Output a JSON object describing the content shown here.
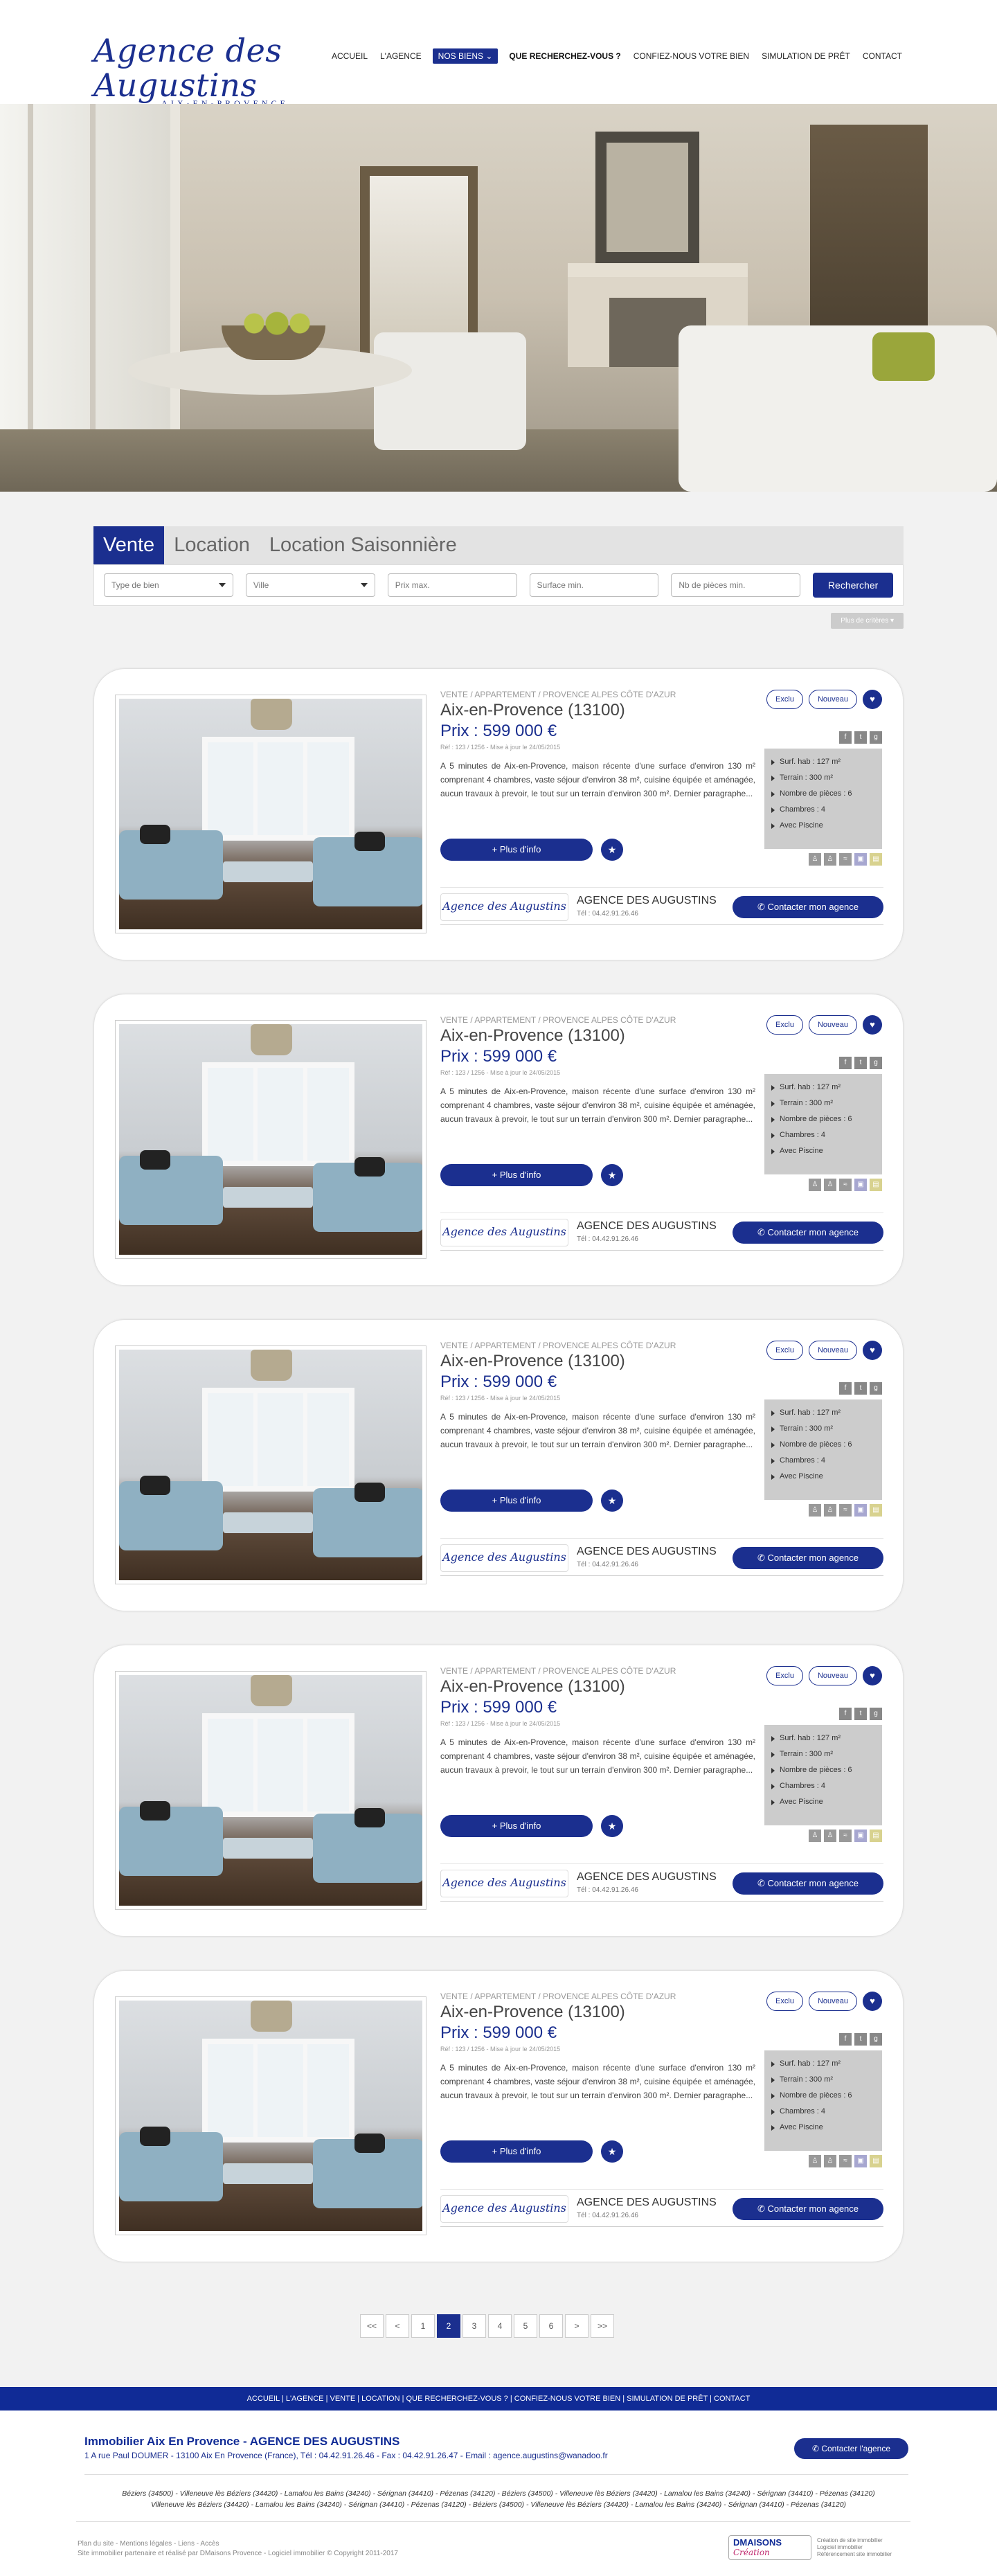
{
  "header": {
    "logo_name": "Agence des Augustins",
    "logo_sub": "AIX-EN-PROVENCE",
    "nav": [
      {
        "label": "ACCUEIL",
        "style": ""
      },
      {
        "label": "L'AGENCE",
        "style": ""
      },
      {
        "label": "NOS BIENS ⌄",
        "style": "active"
      },
      {
        "label": "QUE RECHERCHEZ-VOUS ?",
        "style": "bold"
      },
      {
        "label": "CONFIEZ-NOUS VOTRE BIEN",
        "style": ""
      },
      {
        "label": "SIMULATION DE PRÊT",
        "style": ""
      },
      {
        "label": "CONTACT",
        "style": ""
      }
    ]
  },
  "search": {
    "tabs": [
      "Vente",
      "Location",
      "Location Saisonnière"
    ],
    "fields": {
      "type": "Type de bien",
      "ville": "Ville",
      "prix": "Prix max.",
      "surface": "Surface min.",
      "pieces": "Nb de pièces min."
    },
    "button": "Rechercher",
    "more": "Plus de critères ▾"
  },
  "listing": {
    "breadcrumb": "VENTE / APPARTEMENT / PROVENCE ALPES CÔTE D'AZUR",
    "city": "Aix-en-Provence (13100)",
    "price": "Prix : 599 000 €",
    "ref": "Réf : 123 / 1256 - Mise à jour le 24/05/2015",
    "desc": "A 5 minutes de Aix-en-Provence, maison récente d'une surface d'environ 130 m² comprenant 4 chambres, vaste séjour d'environ 38 m², cuisine équipée et aménagée, aucun travaux à prevoir, le tout sur un terrain d'environ 300 m². Dernier paragraphe...",
    "info_button": "+  Plus d'info",
    "badge_exclu": "Exclu",
    "badge_new": "Nouveau",
    "features": [
      "Surf. hab : 127 m²",
      "Terrain : 300 m²",
      "Nombre de pièces : 6",
      "Chambres : 4",
      "Avec Piscine"
    ],
    "agency_logo": "Agence des Augustins",
    "agency_name": "AGENCE DES AUGUSTINS",
    "agency_tel": "Tél : 04.42.91.26.46",
    "contact_button": "Contacter mon agence"
  },
  "pagination": [
    "<<",
    "<",
    "1",
    "2",
    "3",
    "4",
    "5",
    "6",
    ">",
    ">>"
  ],
  "pagination_active": "2",
  "footer": {
    "nav": "ACCUEIL  |  L'AGENCE  |  VENTE  |  LOCATION  |  QUE RECHERCHEZ-VOUS ?  |  CONFIEZ-NOUS VOTRE BIEN  |  SIMULATION DE PRÊT  |  CONTACT",
    "title": "Immobilier Aix En Provence - AGENCE DES AUGUSTINS",
    "address": "1 A rue Paul DOUMER - 13100 Aix En Provence (France), Tél : 04.42.91.26.46 - Fax : 04.42.91.26.47 - Email : agence.augustins@wanadoo.fr",
    "contact_button": "Contacter l'agence",
    "cities_1": "Béziers (34500) - Villeneuve lès Béziers (34420) - Lamalou les Bains (34240) - Sérignan (34410) - Pézenas (34120) - Béziers (34500) - Villeneuve lès Béziers (34420) - Lamalou les Bains (34240) - Sérignan (34410) - Pézenas (34120)",
    "cities_2": "Villeneuve lès Béziers (34420) - Lamalou les Bains (34240) - Sérignan (34410) - Pézenas (34120) - Béziers (34500) - Villeneuve lès Béziers (34420) - Lamalou les Bains (34240) - Sérignan (34410) - Pézenas (34120)",
    "bottom_1": "Plan du site - Mentions légales - Liens - Accès",
    "bottom_2": "Site immobilier partenaire et réalisé par DMaisons Provence - Logiciel immobilier © Copyright 2011-2017",
    "dm_name": "DMAISONS",
    "dm_sub": "Création",
    "dm_text": "Création de site immobilier\nLogiciel immobilier\nRéférencement site immobilier"
  },
  "colors": {
    "brand": "#1b2f8f",
    "footer_bar": "#102b96"
  }
}
